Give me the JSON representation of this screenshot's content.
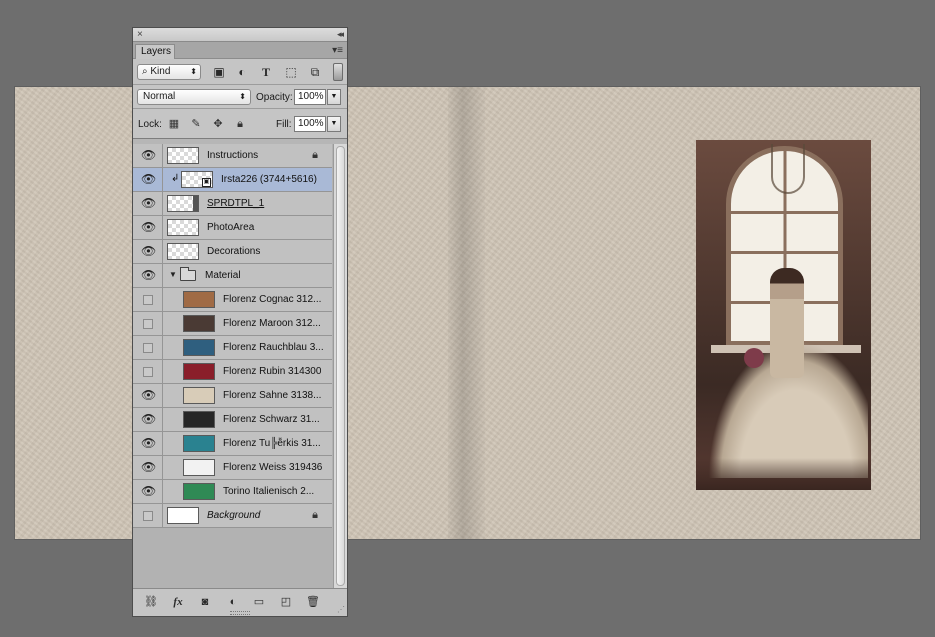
{
  "panel": {
    "tab_label": "Layers",
    "close_glyph": "×",
    "collapse_glyph": "◂◂",
    "menu_glyph": "▾≡",
    "filter": {
      "kind_label": "Kind",
      "kind_prefix": "⌕",
      "icons": [
        "pixel-filter-icon",
        "adjustment-filter-icon",
        "type-filter-icon",
        "shape-filter-icon",
        "smart-object-filter-icon"
      ]
    },
    "blend_mode": "Normal",
    "opacity_label": "Opacity:",
    "opacity_value": "100%",
    "lock_label": "Lock:",
    "fill_label": "Fill:",
    "fill_value": "100%"
  },
  "layers": [
    {
      "name": "Instructions",
      "visible": true,
      "locked": true,
      "thumb": "transparent"
    },
    {
      "name": "Irsta226 (3744+5616)",
      "visible": true,
      "selected": true,
      "clipped": true,
      "smart": true,
      "thumb": "transparent"
    },
    {
      "name": "SPRDTPL_1",
      "visible": true,
      "underline": true,
      "thumb": "transparent-mask"
    },
    {
      "name": "PhotoArea",
      "visible": true,
      "thumb": "transparent"
    },
    {
      "name": "Decorations",
      "visible": true,
      "thumb": "transparent"
    },
    {
      "name": "Material",
      "visible": true,
      "group": true,
      "expanded": true
    },
    {
      "name": "Florenz Cognac 312...",
      "visible": false,
      "indent": true,
      "color": "#a06b45"
    },
    {
      "name": "Florenz Maroon 312...",
      "visible": false,
      "indent": true,
      "color": "#4a3a34"
    },
    {
      "name": "Florenz Rauchblau 3...",
      "visible": false,
      "indent": true,
      "color": "#2f5f7f"
    },
    {
      "name": "Florenz Rubin 314300",
      "visible": false,
      "indent": true,
      "color": "#8a1e2a"
    },
    {
      "name": "Florenz Sahne 3138...",
      "visible": true,
      "indent": true,
      "color": "#d8ccb8"
    },
    {
      "name": "Florenz Schwarz 31...",
      "visible": true,
      "indent": true,
      "color": "#262626"
    },
    {
      "name": "Florenz Tu╠ê̈rkis 31...",
      "visible": true,
      "indent": true,
      "color": "#2a8290"
    },
    {
      "name": "Florenz Weiss 319436",
      "visible": true,
      "indent": true,
      "color": "#f2f2f2"
    },
    {
      "name": "Torino Italienisch 2...",
      "visible": true,
      "indent": true,
      "color": "#2f8a55"
    },
    {
      "name": "Background",
      "visible": false,
      "italic": true,
      "locked": true,
      "thumb": "white"
    }
  ],
  "footer_icons": [
    "link-layers-icon",
    "fx-icon",
    "mask-icon",
    "adjustment-layer-icon",
    "new-group-icon",
    "new-layer-icon",
    "trash-icon"
  ],
  "footer_fx_label": "fx",
  "colors": {
    "canvas_bg": "#6e6e6e",
    "leather": "#cfc5b6",
    "selected_row": "#a9b9d6"
  }
}
